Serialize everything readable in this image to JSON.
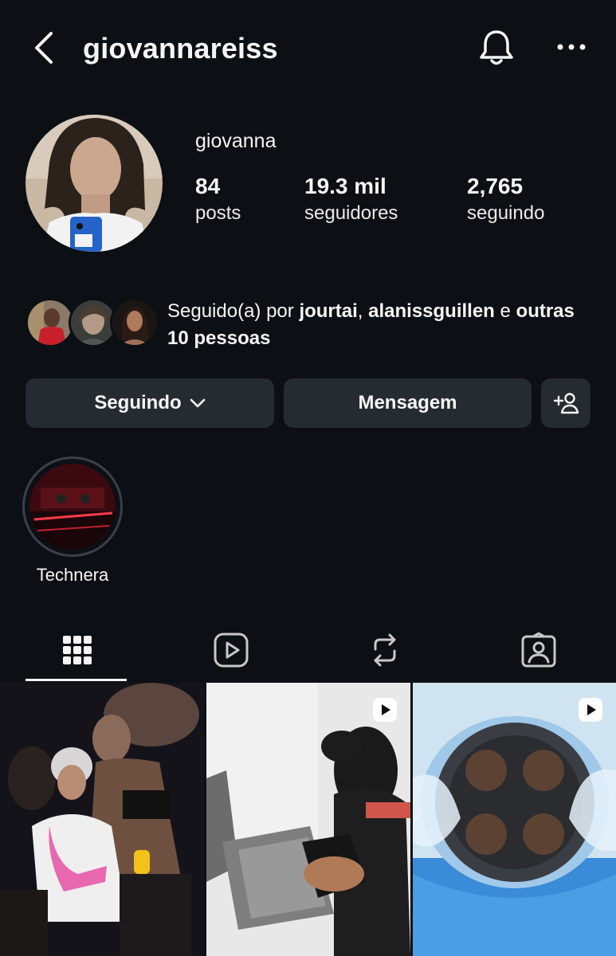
{
  "header": {
    "username": "giovannareiss",
    "back_icon": "chevron-left-icon",
    "bell_icon": "bell-icon",
    "more_icon": "more-horizontal-icon"
  },
  "profile": {
    "display_name": "giovanna",
    "stats": [
      {
        "value": "84",
        "label": "posts"
      },
      {
        "value": "19.3 mil",
        "label": "seguidores"
      },
      {
        "value": "2,765",
        "label": "seguindo"
      }
    ]
  },
  "mutuals": {
    "prefix": "Seguido(a) por ",
    "names": [
      "jourtai",
      "alanissguillen"
    ],
    "separator": ", ",
    "conjunction": " e ",
    "others": "outras 10 pessoas"
  },
  "actions": {
    "following_label": "Seguindo",
    "message_label": "Mensagem",
    "add_user_icon": "add-user-icon"
  },
  "highlights": [
    {
      "label": "Technera"
    }
  ],
  "tabs": [
    {
      "icon": "grid-icon",
      "active": true
    },
    {
      "icon": "reels-icon",
      "active": false
    },
    {
      "icon": "repost-icon",
      "active": false
    },
    {
      "icon": "tagged-icon",
      "active": false
    }
  ],
  "posts": [
    {
      "type": "photo"
    },
    {
      "type": "reel"
    },
    {
      "type": "reel"
    }
  ],
  "colors": {
    "background": "#0c1014",
    "button": "#262a31",
    "text": "#f5f5f5"
  }
}
